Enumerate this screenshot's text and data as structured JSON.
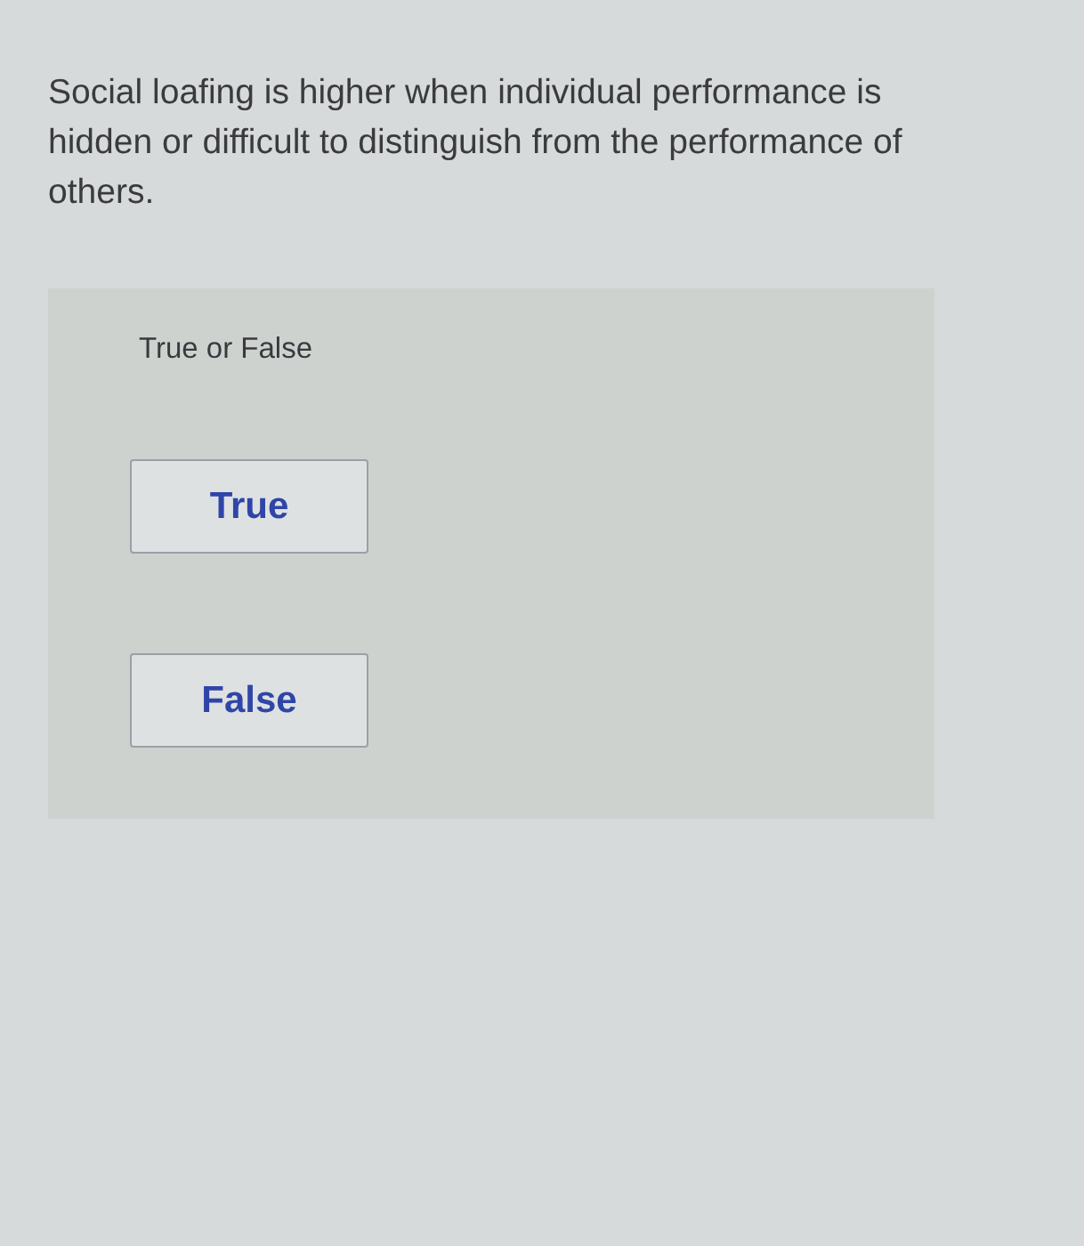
{
  "question": {
    "text": "Social loafing is higher when individual performance is hidden or difficult to distinguish from the performance of others."
  },
  "answer_panel": {
    "prompt": "True or False",
    "options": [
      {
        "label": "True"
      },
      {
        "label": "False"
      }
    ]
  }
}
